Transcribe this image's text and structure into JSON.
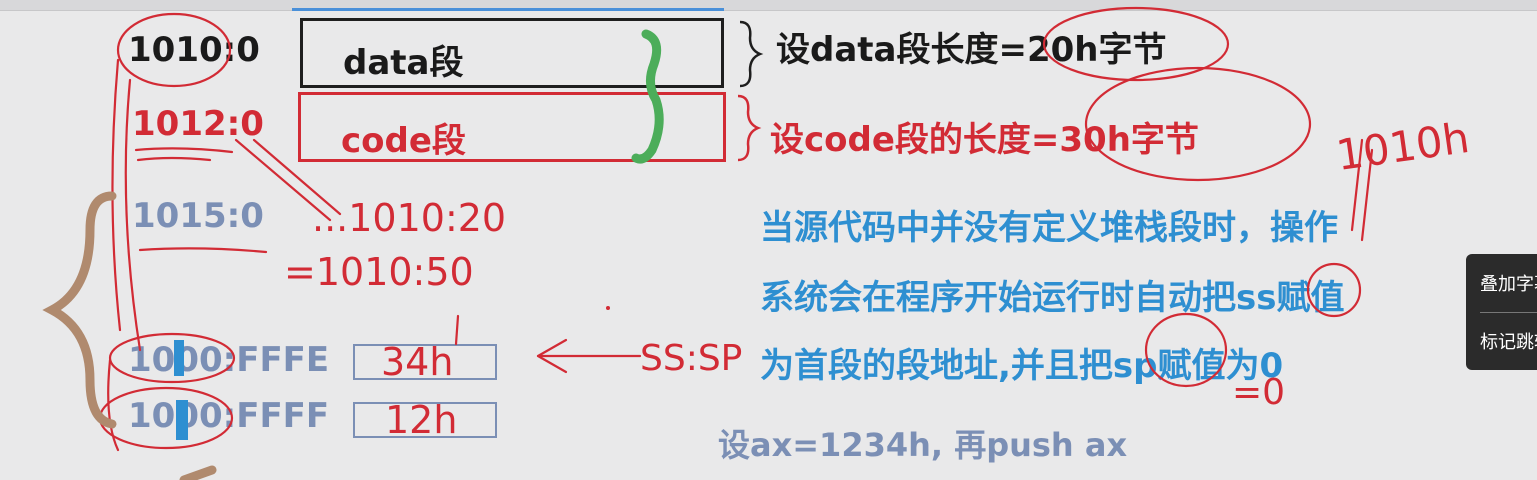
{
  "addresses": {
    "a1010": "1010:0",
    "a1012": "1012:0",
    "a1015": "1015:0",
    "fffe": "1000:FFFE",
    "ffff": "1000:FFFF"
  },
  "segments": {
    "data_label": "data段",
    "code_label": "code段"
  },
  "stack_cells": {
    "fffe_value": "34h",
    "ffff_value": "12h"
  },
  "annotations": {
    "calc1": "...1010:20",
    "calc2": "=1010:50",
    "arrow_label": "SS:SP",
    "right_hex": "1010h",
    "sp_zero": "=0"
  },
  "notes": {
    "data_len": "设data段长度=20h字节",
    "code_len": "设code段的长度=30h字节",
    "line1": "当源代码中并没有定义堆栈段时，操作",
    "line2": "系统会在程序开始运行时自动把ss赋值",
    "line3": "为首段的段地址,并且把sp赋值为0",
    "push": "设ax=1234h, 再push ax"
  },
  "popup_menu": {
    "item1": "叠加字幕",
    "item2": "标记跳转"
  },
  "colors": {
    "red": "#d22b35",
    "blue": "#2e8fd1",
    "steel": "#7b8fb5",
    "green": "#4cad5a",
    "brown": "#b08a6e"
  }
}
